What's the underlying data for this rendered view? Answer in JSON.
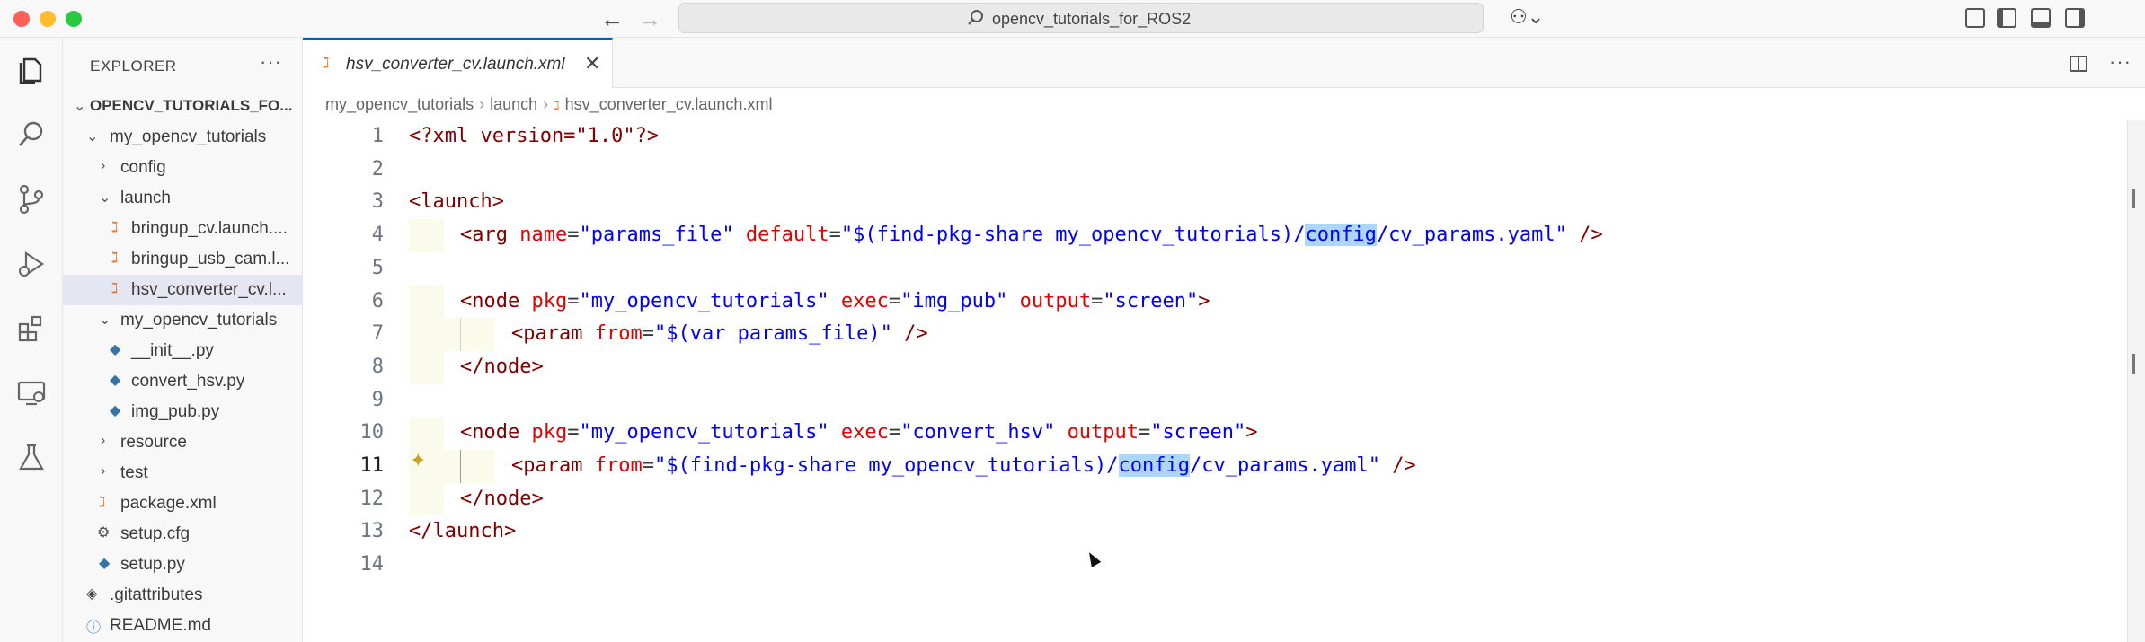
{
  "window": {
    "command_center": "opencv_tutorials_for_ROS2"
  },
  "sidebar": {
    "header": "EXPLORER",
    "more": "···",
    "tree": [
      {
        "label": "OPENCV_TUTORIALS_FO...",
        "type": "root",
        "expanded": true
      },
      {
        "label": "my_opencv_tutorials",
        "type": "folder",
        "expanded": true
      },
      {
        "label": "config",
        "type": "folder",
        "expanded": false
      },
      {
        "label": "launch",
        "type": "folder",
        "expanded": true
      },
      {
        "label": "bringup_cv.launch....",
        "type": "xml"
      },
      {
        "label": "bringup_usb_cam.l...",
        "type": "xml"
      },
      {
        "label": "hsv_converter_cv.l...",
        "type": "xml",
        "selected": true
      },
      {
        "label": "my_opencv_tutorials",
        "type": "folder",
        "expanded": true
      },
      {
        "label": "__init__.py",
        "type": "py"
      },
      {
        "label": "convert_hsv.py",
        "type": "py"
      },
      {
        "label": "img_pub.py",
        "type": "py"
      },
      {
        "label": "resource",
        "type": "folder",
        "expanded": false
      },
      {
        "label": "test",
        "type": "folder",
        "expanded": false
      },
      {
        "label": "package.xml",
        "type": "xml"
      },
      {
        "label": "setup.cfg",
        "type": "gear"
      },
      {
        "label": "setup.py",
        "type": "py"
      },
      {
        "label": ".gitattributes",
        "type": "git"
      },
      {
        "label": "README.md",
        "type": "info"
      }
    ]
  },
  "editor": {
    "tab": {
      "label": "hsv_converter_cv.launch.xml",
      "close": "✕"
    },
    "breadcrumb": [
      "my_opencv_tutorials",
      "launch",
      "hsv_converter_cv.launch.xml"
    ],
    "active_line": 11,
    "lines": [
      "1",
      "2",
      "3",
      "4",
      "5",
      "6",
      "7",
      "8",
      "9",
      "10",
      "11",
      "12",
      "13",
      "14"
    ],
    "code": {
      "l1_pi": "<?xml version=\"1.0\"?>",
      "l3_tag": "launch",
      "l4_tag": "arg",
      "l4_attr1": "name",
      "l4_val1": "\"params_file\"",
      "l4_attr2": "default",
      "l4_val2_pre": "\"$(find-pkg-share my_opencv_tutorials)/",
      "l4_val2_sel": "config",
      "l4_val2_post": "/cv_params.yaml\"",
      "l6_tag": "node",
      "l6_attr1": "pkg",
      "l6_val1": "\"my_opencv_tutorials\"",
      "l6_attr2": "exec",
      "l6_val2": "\"img_pub\"",
      "l6_attr3": "output",
      "l6_val3": "\"screen\"",
      "l7_tag": "param",
      "l7_attr1": "from",
      "l7_val1": "\"$(var params_file)\"",
      "l8_tag": "node",
      "l10_tag": "node",
      "l10_attr1": "pkg",
      "l10_val1": "\"my_opencv_tutorials\"",
      "l10_attr2": "exec",
      "l10_val2": "\"convert_hsv\"",
      "l10_attr3": "output",
      "l10_val3": "\"screen\"",
      "l11_tag": "param",
      "l11_attr1": "from",
      "l11_val1_pre": "\"$(find-pkg-share my_opencv_tutorials)/",
      "l11_val1_sel": "config",
      "l11_val1_post": "/cv_params.yaml\"",
      "l12_tag": "node",
      "l13_tag": "launch"
    }
  },
  "colors": {
    "tag": "#800000",
    "attribute": "#e50000",
    "string": "#0000ff",
    "selection": "#add6ff",
    "accent": "#005fb8"
  }
}
